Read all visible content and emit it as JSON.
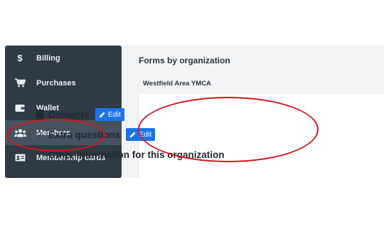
{
  "sidebar": {
    "items": [
      {
        "label": "Billing",
        "icon": "dollar-icon"
      },
      {
        "label": "Purchases",
        "icon": "cart-icon"
      },
      {
        "label": "Wallet",
        "icon": "wallet-icon"
      },
      {
        "label": "Members",
        "icon": "members-icon"
      },
      {
        "label": "Membership cards",
        "icon": "id-card-icon"
      }
    ],
    "active": "Members"
  },
  "main": {
    "title": "Forms by organization",
    "organization": "Westfield Area YMCA",
    "forms": [
      {
        "label": "Contacts",
        "icon": "book-icon",
        "action": "Edit"
      },
      {
        "label": "Extra questions",
        "icon": "question-icon",
        "action": "Edit"
      },
      {
        "label": "Other information for this organization",
        "icon": "question-icon"
      }
    ]
  },
  "colors": {
    "sidebar_bg": "#2f3a44",
    "active_bg": "#46525d",
    "edit_button": "#1a73e8",
    "highlight_oval": "#d8141f"
  }
}
